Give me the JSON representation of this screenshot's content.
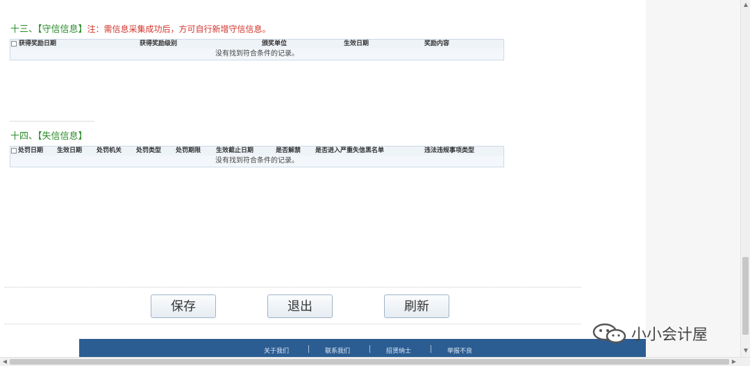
{
  "section13": {
    "title": "十三、【守信信息】",
    "note": "注：需信息采集成功后，方可自行新增守信信息。",
    "columns": [
      "获得奖励日期",
      "获得奖励级别",
      "颁奖单位",
      "生效日期",
      "奖励内容"
    ],
    "empty_text": "没有找到符合条件的记录。"
  },
  "section14": {
    "title": "十四、【失信信息】",
    "columns": [
      "处罚日期",
      "生效日期",
      "处罚机关",
      "处罚类型",
      "处罚期限",
      "生效截止日期",
      "是否解禁",
      "是否进入严重失信黑名单",
      "违法违规事项类型"
    ],
    "empty_text": "没有找到符合条件的记录。"
  },
  "buttons": {
    "save": "保存",
    "exit": "退出",
    "refresh": "刷新"
  },
  "footer": {
    "links": [
      "关于我们",
      "联系我们",
      "招贤纳士",
      "举报不良"
    ]
  },
  "watermark": {
    "text": "小小会计屋",
    "icon": "wechat-icon"
  }
}
